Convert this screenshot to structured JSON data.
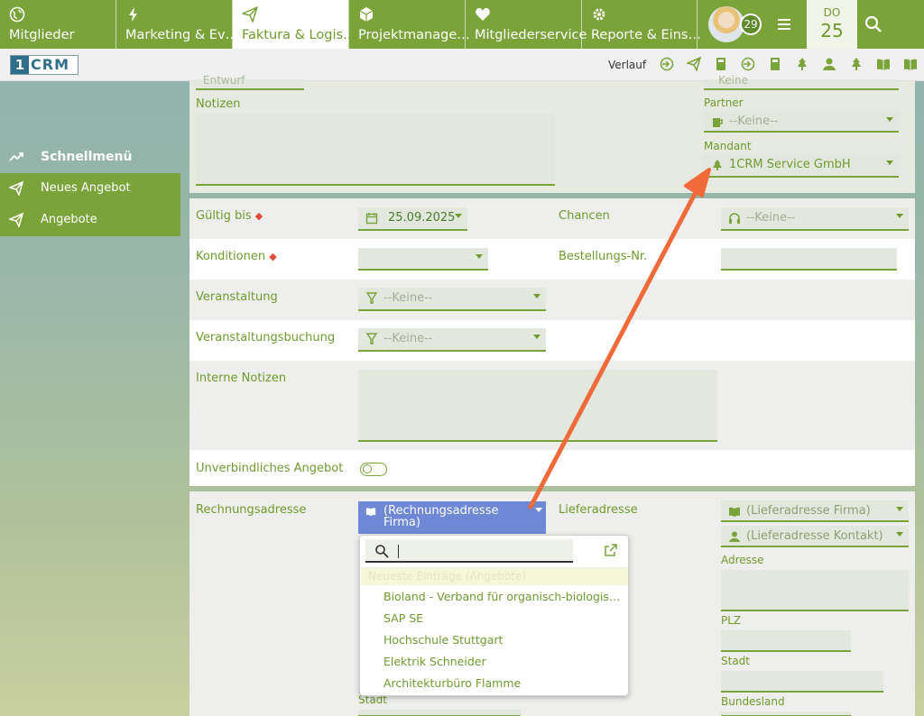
{
  "nav": {
    "tabs": [
      {
        "label": "Mitglieder",
        "icon": "globe-icon"
      },
      {
        "label": "Marketing & Ev…",
        "icon": "lightning-icon"
      },
      {
        "label": "Faktura & Logis…",
        "icon": "paper-plane-icon"
      },
      {
        "label": "Projektmanage…",
        "icon": "cube-icon"
      },
      {
        "label": "Mitgliederservice",
        "icon": "heart-icon"
      },
      {
        "label": "Reporte & Eins…",
        "icon": "gear-icon"
      }
    ],
    "notification_count": "29",
    "date": {
      "weekday": "DO",
      "day": "25"
    }
  },
  "toolbar": {
    "logo_number": "1",
    "logo_text": "CRM",
    "history_label": "Verlauf"
  },
  "quickmenu": {
    "title": "Schnellmenü",
    "items": [
      {
        "label": "Neues Angebot",
        "icon": "paper-plane-icon"
      },
      {
        "label": "Angebote",
        "icon": "paper-plane-icon"
      }
    ]
  },
  "form": {
    "status_value": "Entwurf",
    "top_right_value": "Keine",
    "notes_label": "Notizen",
    "partner_label": "Partner",
    "partner_value": "--Keine--",
    "mandant_label": "Mandant",
    "mandant_value": "1CRM Service GmbH",
    "valid_until_label": "Gültig bis",
    "valid_until_value": "25.09.2025",
    "chances_label": "Chancen",
    "chances_value": "--Keine--",
    "conditions_label": "Konditionen",
    "order_no_label": "Bestellungs-Nr.",
    "event_label": "Veranstaltung",
    "event_value": "--Keine--",
    "event_booking_label": "Veranstaltungsbuchung",
    "event_booking_value": "--Keine--",
    "internal_notes_label": "Interne Notizen",
    "non_binding_label": "Unverbindliches Angebot",
    "billing_label": "Rechnungsadresse",
    "billing_value": "(Rechnungsadresse Firma)",
    "shipping_label": "Lieferadresse",
    "shipping_company_value": "(Lieferadresse Firma)",
    "shipping_contact_value": "(Lieferadresse Kontakt)",
    "address_label": "Adresse",
    "zip_label": "PLZ",
    "city_label": "Stadt",
    "state_label": "Bundesland",
    "billing_city_label": "Stadt"
  },
  "dropdown": {
    "highlight_text": "Neueste Einträge (Angebote)",
    "items": [
      "Bioland - Verband für organisch-biologischen Landbau",
      "SAP SE",
      "Hochschule Stuttgart",
      "Elektrik Schneider",
      "Architekturbüro Flamme"
    ]
  },
  "colors": {
    "brand_green": "#7aa33a",
    "arrow": "#f06a3a",
    "selected_blue": "#6f88d6"
  }
}
